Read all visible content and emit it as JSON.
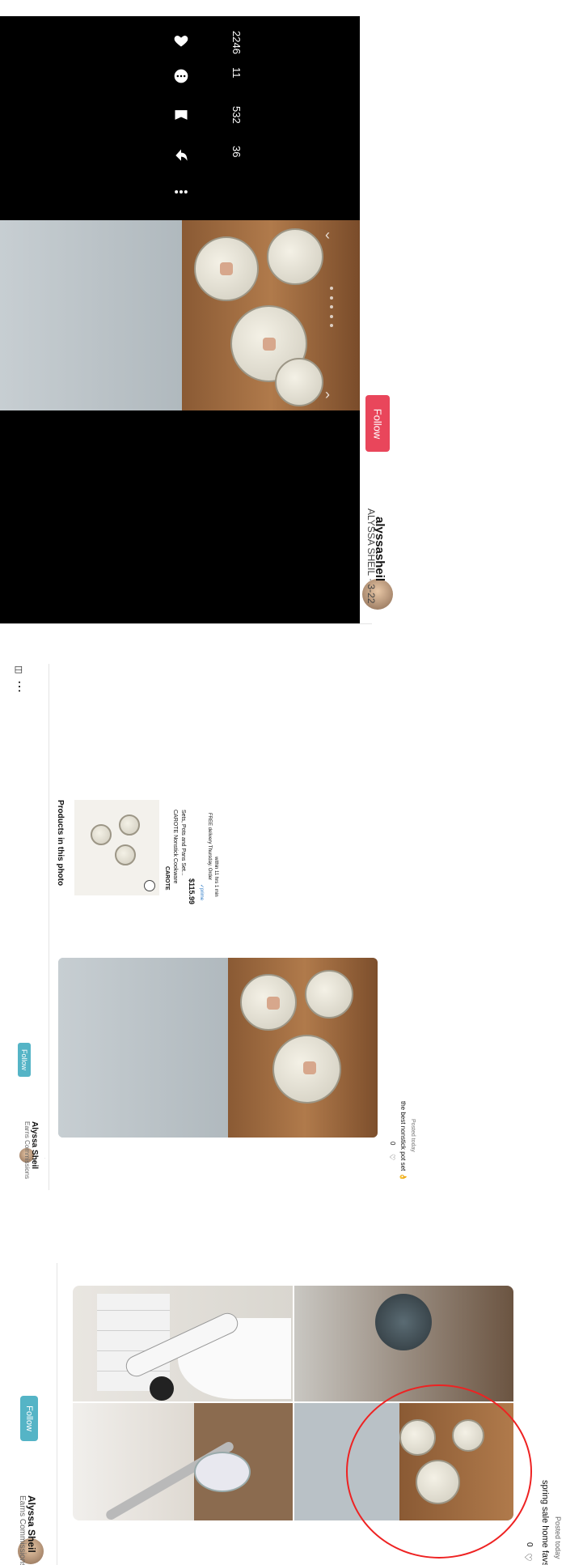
{
  "video_view": {
    "stats": {
      "likes": "2246",
      "comments": "11",
      "saves": "532",
      "shares": "36"
    },
    "author": {
      "handle": "alyssasheil",
      "subtitle": "ALYSSA SHEIL · 3-22"
    },
    "follow_label": "Follow"
  },
  "post_detail": {
    "author_name": "Alyssa Sheil",
    "author_sub": "Earns Commissions",
    "follow_label": "Follow",
    "products_heading": "Products in this photo",
    "product": {
      "brand": "CAROTE",
      "title_line1": "CAROTE Nonstick Cookware",
      "title_line2": "Sets, Pots and Pans Set...",
      "price": "$115.99",
      "prime": "✓prime",
      "delivery_line1": "FREE delivery Thursday. Order",
      "delivery_line2": "within 11 hrs 1 min"
    },
    "likes": "0",
    "caption": "the best nonstick pot set 👌",
    "posted": "Posted today"
  },
  "collage_post": {
    "author_name": "Alyssa Sheil",
    "author_sub": "Earns Commissions",
    "follow_label": "Follow",
    "likes": "0",
    "caption": "spring sale home favs",
    "posted": "Posted today"
  },
  "colors": {
    "follow_red": "#e9465b",
    "follow_teal": "#55b4c6",
    "highlight_circle": "#e22222"
  }
}
